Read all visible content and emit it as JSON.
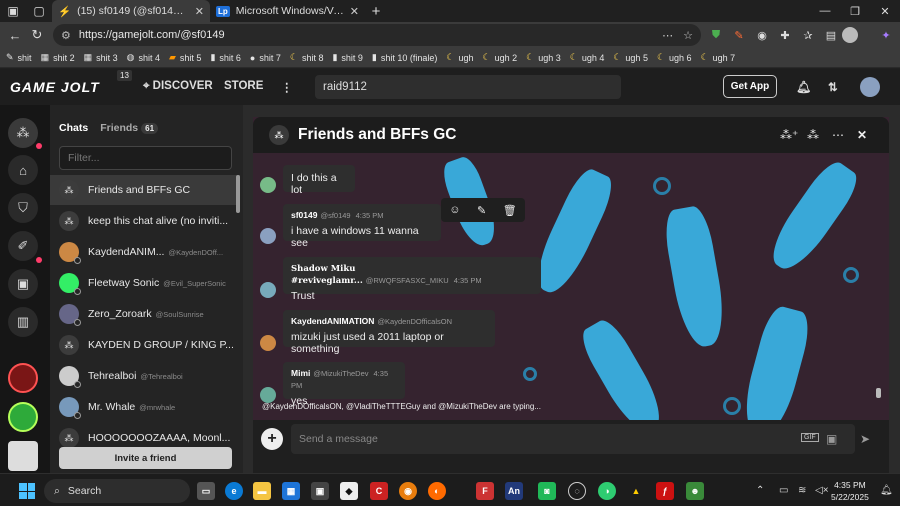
{
  "browser": {
    "tabs": [
      {
        "title": "(15) sf0149 (@sf0149) - Game Jolt",
        "active": true
      },
      {
        "title": "Microsoft Windows/Versions | Loi",
        "active": false
      }
    ],
    "url": "https://gamejolt.com/@sf0149",
    "bookmarks": [
      "shit",
      "shit 2",
      "shit 3",
      "shit 4",
      "shit 5",
      "shit 6",
      "shit 7",
      "shit 8",
      "shit 9",
      "shit 10 (finale)",
      "ugh",
      "ugh 2",
      "ugh 3",
      "ugh 4",
      "ugh 5",
      "ugh 6",
      "ugh 7"
    ]
  },
  "header": {
    "logo": "GAME JOLT",
    "logo_badge": "13",
    "discover": "DISCOVER",
    "store": "STORE",
    "search_value": "raid9112",
    "get_app": "Get App"
  },
  "panel": {
    "tab_chats": "Chats",
    "tab_friends": "Friends",
    "friends_count": "61",
    "filter_placeholder": "Filter...",
    "items": [
      {
        "name": "Friends and BFFs GC",
        "handle": "",
        "group": true
      },
      {
        "name": "keep this chat alive (no inviti...",
        "handle": "",
        "group": true
      },
      {
        "name": "KaydendANIM...",
        "handle": "@KaydenDOff...",
        "group": false
      },
      {
        "name": "Fleetway Sonic",
        "handle": "@Evil_SuperSonic",
        "group": false
      },
      {
        "name": "Zero_Zoroark",
        "handle": "@SoulSunrise",
        "group": false
      },
      {
        "name": "KAYDEN D GROUP / KING P...",
        "handle": "",
        "group": true
      },
      {
        "name": "Tehrealboi",
        "handle": "@Tehrealboi",
        "group": false
      },
      {
        "name": "Mr. Whale",
        "handle": "@mrwhale",
        "group": false
      },
      {
        "name": "HOOOOOOOZAAAA, Moonl...",
        "handle": "",
        "group": true
      }
    ],
    "invite": "Invite a friend"
  },
  "chat": {
    "title": "Friends and BFFs GC",
    "messages": [
      {
        "name": "",
        "handle": "",
        "time": "",
        "text": "I do this a lot"
      },
      {
        "name": "sf0149",
        "handle": "@sf0149",
        "time": "4:35 PM",
        "text": "i have a windows 11 wanna see"
      },
      {
        "name": "Shadow Miku #reviveglamr...",
        "handle": "@RWQFSFASXC_MIKU",
        "time": "4:35 PM",
        "text": "Trust"
      },
      {
        "name": "KaydendANIMATION",
        "handle": "@KaydenDOfficalsON",
        "time": "4:35 PM",
        "text": "mizuki just used a 2011 laptop or something"
      },
      {
        "name": "Mimi",
        "handle": "@MizukiTheDev",
        "time": "4:35 PM",
        "text": "yes"
      }
    ],
    "typing": "@KaydenDOfficalsON, @VladiTheTTTEGuy and @MizukiTheDev are typing...",
    "placeholder": "Send a message",
    "gif": "GIF"
  },
  "taskbar": {
    "search": "Search",
    "time": "4:35 PM",
    "date": "5/22/2025"
  },
  "colors": {
    "accent": "#39a8d8",
    "notify": "#ff3c6a"
  }
}
